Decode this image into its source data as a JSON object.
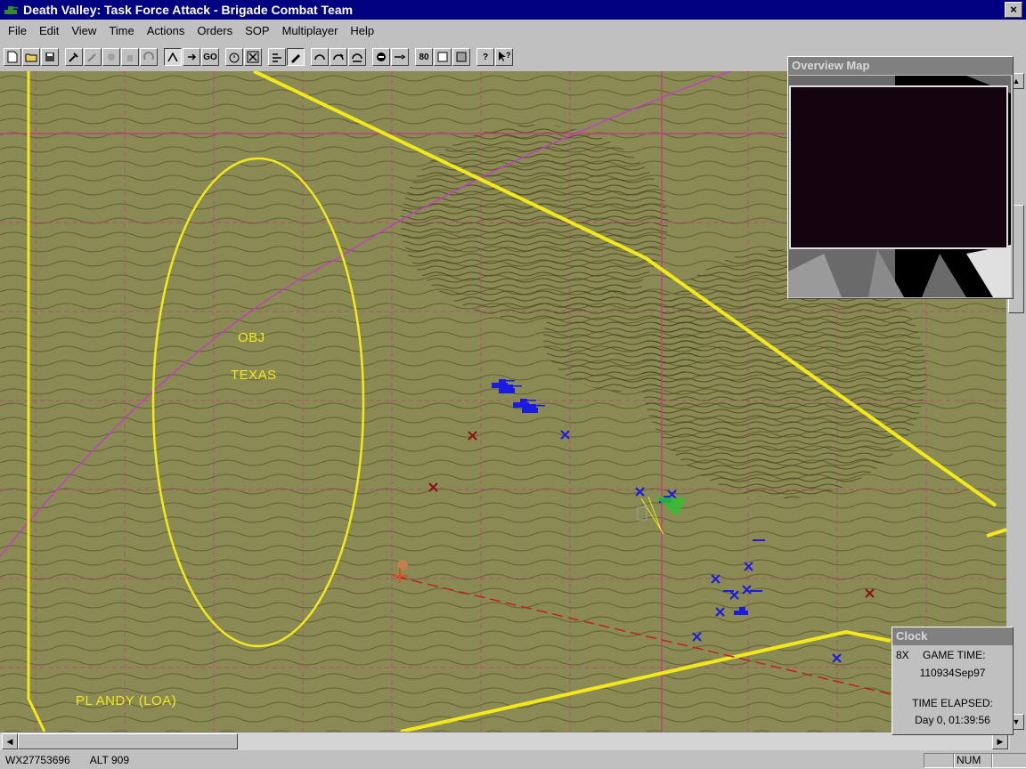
{
  "window": {
    "title": "Death Valley:  Task Force Attack - Brigade Combat Team",
    "close_label": "×",
    "app_icon": "tank-icon"
  },
  "menu": [
    "File",
    "Edit",
    "View",
    "Time",
    "Actions",
    "Orders",
    "SOP",
    "Multiplayer",
    "Help"
  ],
  "toolbar": {
    "go_label": "GO",
    "zoom_label": "80",
    "help_label": "?"
  },
  "map": {
    "objective_line1": "OBJ",
    "objective_line2": "TEXAS",
    "phase_line": "PL ANDY (LOA)",
    "colors": {
      "terrain": "#8a8a55",
      "contour": "#3f3e17",
      "boundary": "#f2e81a",
      "grid": "#c04080",
      "friendly": "#1a1ae0",
      "enemy": "#8a1010"
    }
  },
  "overview": {
    "title": "Overview Map"
  },
  "clock": {
    "title": "Clock",
    "speed": "8X",
    "game_time_label": "GAME TIME:",
    "game_time": "110934Sep97",
    "elapsed_label": "TIME ELAPSED:",
    "elapsed": "Day 0, 01:39:56"
  },
  "status": {
    "grid_ref": "WX27753696",
    "altitude": "ALT  909",
    "num": "NUM"
  }
}
